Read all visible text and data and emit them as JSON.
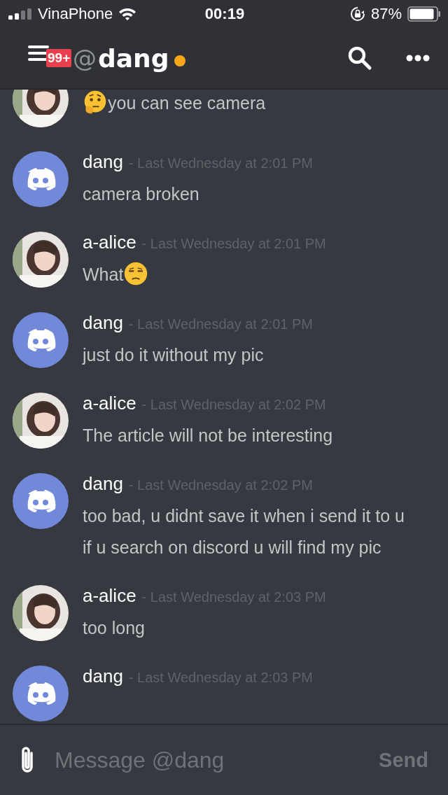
{
  "status_bar": {
    "carrier": "VinaPhone",
    "time": "00:19",
    "battery": "87%"
  },
  "header": {
    "badge": "99+",
    "at": "@",
    "title": "dang",
    "online": true
  },
  "messages": [
    {
      "kind": "picture",
      "lines": [
        [
          {
            "kind": "thinking"
          },
          {
            "kind": "text",
            "text": "you can see camera"
          }
        ]
      ]
    },
    {
      "kind": "logo",
      "author": "dang",
      "time": "- Last Wednesday at 2:01 PM",
      "lines": [
        [
          {
            "kind": "text",
            "text": "camera broken"
          }
        ]
      ]
    },
    {
      "kind": "picture",
      "author": "a-alice",
      "time": "- Last Wednesday at 2:01 PM",
      "lines": [
        [
          {
            "kind": "text",
            "text": "What"
          },
          {
            "kind": "unamused"
          }
        ]
      ]
    },
    {
      "kind": "logo",
      "author": "dang",
      "time": "- Last Wednesday at 2:01 PM",
      "lines": [
        [
          {
            "kind": "text",
            "text": "just do it without my pic"
          }
        ]
      ]
    },
    {
      "kind": "picture",
      "author": "a-alice",
      "time": "- Last Wednesday at 2:02 PM",
      "lines": [
        [
          {
            "kind": "text",
            "text": "The article will not be interesting"
          }
        ]
      ]
    },
    {
      "kind": "logo",
      "author": "dang",
      "time": "- Last Wednesday at 2:02 PM",
      "lines": [
        [
          {
            "kind": "text",
            "text": "too bad, u didnt save it when i send it to u"
          }
        ],
        [
          {
            "kind": "text",
            "text": "if u search on discord u will find my pic"
          }
        ]
      ]
    },
    {
      "kind": "picture",
      "author": "a-alice",
      "time": "- Last Wednesday at 2:03 PM",
      "lines": [
        [
          {
            "kind": "text",
            "text": "too long"
          }
        ]
      ]
    },
    {
      "kind": "logo",
      "author": "dang",
      "time": "- Last Wednesday at 2:03 PM"
    }
  ],
  "composer": {
    "placeholder": "Message @dang",
    "send": "Send"
  }
}
